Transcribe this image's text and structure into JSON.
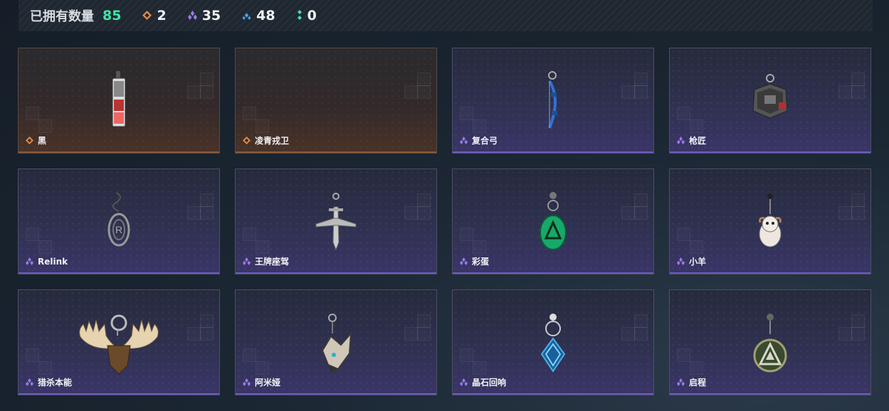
{
  "stats": {
    "owned_label": "已拥有数量",
    "owned_count": "85",
    "rarities": [
      {
        "icon": "orange-rarity-icon",
        "color": "#e08a4a",
        "count": "2"
      },
      {
        "icon": "purple-rarity-icon",
        "color": "#9a7be8",
        "count": "35"
      },
      {
        "icon": "blue-rarity-icon",
        "color": "#4aa3e8",
        "count": "48"
      },
      {
        "icon": "green-rarity-icon",
        "color": "#3fe6a8",
        "count": "0"
      }
    ]
  },
  "items": [
    {
      "label": "黑",
      "rarity": "orange",
      "icon": "phone-charm-icon"
    },
    {
      "label": "凌青戎卫",
      "rarity": "orange",
      "icon": "empty"
    },
    {
      "label": "复合弓",
      "rarity": "purple",
      "icon": "bow-charm-icon"
    },
    {
      "label": "枪匠",
      "rarity": "purple",
      "icon": "gunsmith-box-charm-icon"
    },
    {
      "label": "Relink",
      "rarity": "purple",
      "icon": "relink-emblem-charm-icon"
    },
    {
      "label": "王牌座驾",
      "rarity": "purple",
      "icon": "jet-plane-charm-icon"
    },
    {
      "label": "彩蛋",
      "rarity": "purple",
      "icon": "green-egg-charm-icon"
    },
    {
      "label": "小羊",
      "rarity": "purple",
      "icon": "lamb-charm-icon"
    },
    {
      "label": "猎杀本能",
      "rarity": "purple",
      "icon": "moose-antler-charm-icon"
    },
    {
      "label": "阿米娅",
      "rarity": "purple",
      "icon": "fox-head-charm-icon"
    },
    {
      "label": "晶石回响",
      "rarity": "purple",
      "icon": "crystal-charm-icon"
    },
    {
      "label": "启程",
      "rarity": "purple",
      "icon": "triangle-medal-charm-icon"
    }
  ]
}
